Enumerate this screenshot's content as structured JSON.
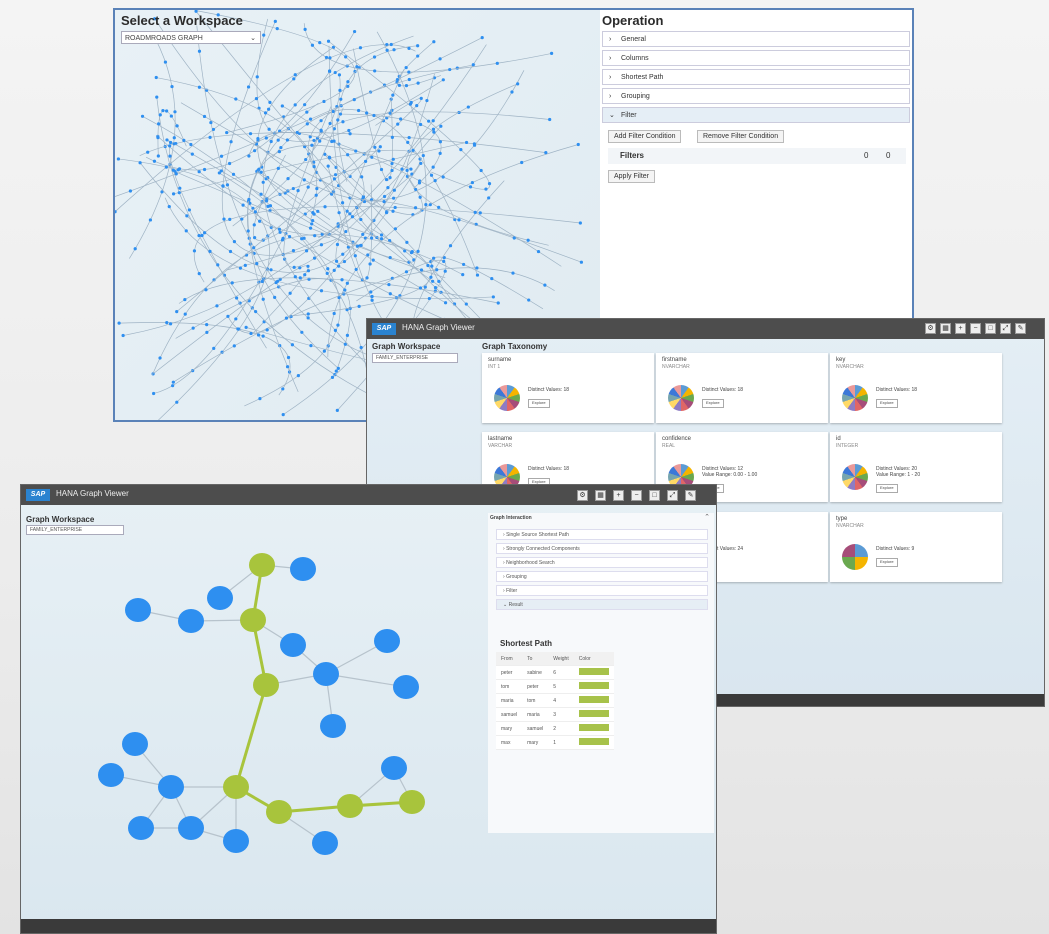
{
  "back_window": {
    "workspace_title": "Select a Workspace",
    "workspace_select": "ROADMROADS GRAPH",
    "operation_title": "Operation",
    "sections": [
      {
        "label": "General",
        "open": false
      },
      {
        "label": "Columns",
        "open": false
      },
      {
        "label": "Shortest Path",
        "open": false
      },
      {
        "label": "Grouping",
        "open": false
      },
      {
        "label": "Filter",
        "open": true
      }
    ],
    "add_filter_button": "Add Filter Condition",
    "remove_filter_button": "Remove Filter Condition",
    "filters_label": "Filters",
    "filters_count_a": "0",
    "filters_count_b": "0",
    "apply_filter_button": "Apply Filter"
  },
  "middle_window": {
    "app_title": "HANA Graph Viewer",
    "logo": "SAP",
    "workspace_label": "Graph Workspace",
    "workspace_select": "FAMILY_ENTERPRISE",
    "taxonomy_label": "Graph Taxonomy",
    "cards": [
      {
        "title": "surname",
        "sub": "INT 1",
        "lines": [
          "Distinct Values: 18"
        ],
        "button": "Explore"
      },
      {
        "title": "firstname",
        "sub": "NVARCHAR",
        "lines": [
          "Distinct Values: 18"
        ],
        "button": "Explore"
      },
      {
        "title": "key",
        "sub": "NVARCHAR",
        "lines": [
          "Distinct Values: 18"
        ],
        "button": "Explore"
      },
      {
        "title": "lastname",
        "sub": "VARCHAR",
        "lines": [
          "Distinct Values: 18"
        ],
        "button": "Explore"
      },
      {
        "title": "confidence",
        "sub": "REAL",
        "lines": [
          "Distinct Values: 12",
          "Value Range: 0.00 - 1.00"
        ],
        "button": "Explore"
      },
      {
        "title": "id",
        "sub": "INTEGER",
        "lines": [
          "Distinct Values: 20",
          "Value Range: 1 - 20"
        ],
        "button": "Explore"
      },
      {
        "title": "",
        "sub": "",
        "lines": [
          "Distinct Values: 24"
        ],
        "button": ""
      },
      {
        "title": "type",
        "sub": "NVARCHAR",
        "lines": [
          "Distinct Values: 9"
        ],
        "button": "Explore"
      }
    ]
  },
  "front_window": {
    "app_title": "HANA Graph Viewer",
    "logo": "SAP",
    "workspace_label": "Graph Workspace",
    "workspace_select": "FAMILY_ENTERPRISE",
    "interaction_label": "Graph Interaction",
    "sections": [
      {
        "label": "Single Source Shortest Path",
        "open": false
      },
      {
        "label": "Strongly Connected Components",
        "open": false
      },
      {
        "label": "Neighborhood Search",
        "open": false
      },
      {
        "label": "Grouping",
        "open": false
      },
      {
        "label": "Filter",
        "open": false
      },
      {
        "label": "Result",
        "open": true
      }
    ],
    "shortest_path_title": "Shortest Path",
    "table_headers": [
      "From",
      "To",
      "Weight",
      "Color"
    ],
    "table_rows": [
      [
        "peter",
        "sabine",
        "6",
        "#a7c24a"
      ],
      [
        "tom",
        "peter",
        "5",
        "#a7c24a"
      ],
      [
        "maria",
        "tom",
        "4",
        "#a7c24a"
      ],
      [
        "samuel",
        "maria",
        "3",
        "#a7c24a"
      ],
      [
        "mary",
        "samuel",
        "2",
        "#a7c24a"
      ],
      [
        "max",
        "mary",
        "1",
        "#a7c24a"
      ]
    ]
  },
  "colors": {
    "node_blue": "#2e8ff0",
    "node_green": "#a8c43c",
    "titlebar": "#4d4d4d",
    "sap_blue": "#2a83d0"
  },
  "toolbar_icons": [
    "settings-icon",
    "layout-icon",
    "zoom-in-icon",
    "zoom-out-icon",
    "fit-icon",
    "expand-icon",
    "edit-icon"
  ]
}
